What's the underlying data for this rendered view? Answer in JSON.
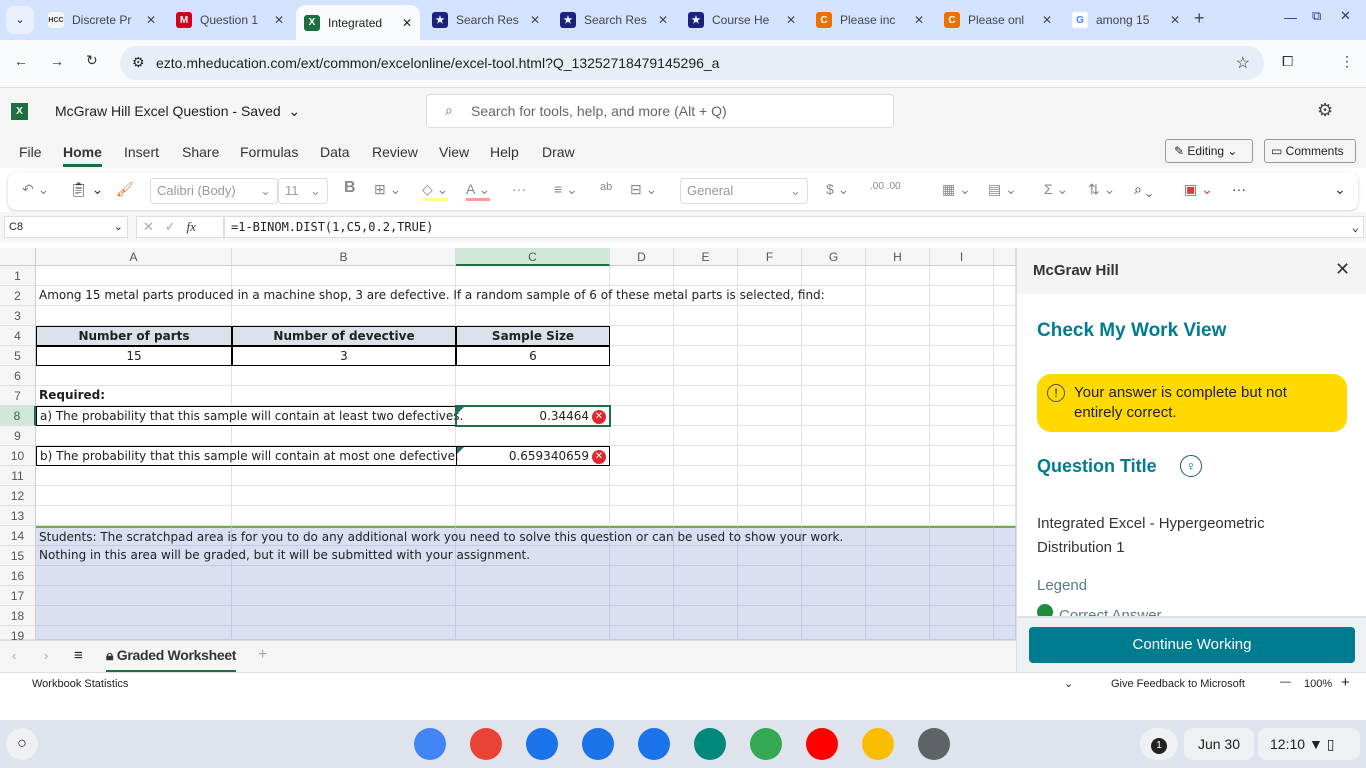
{
  "browser": {
    "tabs": [
      {
        "label": "Discrete Pr",
        "icon": "hcc-icon",
        "color": "#f5f5f5",
        "glyph": "HCC"
      },
      {
        "label": "Question 1",
        "icon": "mcgraw-icon",
        "color": "#d0021b",
        "glyph": "M"
      },
      {
        "label": "Integrated",
        "icon": "excel-icon",
        "color": "#1d6f42",
        "glyph": "X"
      },
      {
        "label": "Search Res",
        "icon": "shield-icon",
        "color": "#1a237e",
        "glyph": "★"
      },
      {
        "label": "Search Res",
        "icon": "shield-icon",
        "color": "#1a237e",
        "glyph": "★"
      },
      {
        "label": "Course He",
        "icon": "shield-icon",
        "color": "#1a237e",
        "glyph": "★"
      },
      {
        "label": "Please inc",
        "icon": "chegg-icon",
        "color": "#eb7100",
        "glyph": "C"
      },
      {
        "label": "Please onl",
        "icon": "chegg-icon",
        "color": "#eb7100",
        "glyph": "C"
      },
      {
        "label": "among 15",
        "icon": "google-icon",
        "color": "#fff",
        "glyph": "G"
      }
    ],
    "url": "ezto.mheducation.com/ext/common/excelonline/excel-tool.html?Q_13252718479145296_a"
  },
  "excel": {
    "title": "McGraw Hill Excel Question",
    "saved": "Saved",
    "search_placeholder": "Search for tools, help, and more (Alt + Q)",
    "menu": [
      "File",
      "Home",
      "Insert",
      "Share",
      "Formulas",
      "Data",
      "Review",
      "View",
      "Help",
      "Draw"
    ],
    "active_menu": "Home",
    "editing": "Editing",
    "comments": "Comments",
    "font": "Calibri (Body)",
    "font_size": "11",
    "number_format": "General",
    "name_box": "C8",
    "formula": "=1-BINOM.DIST(1,C5,0.2,TRUE)",
    "columns": [
      "A",
      "B",
      "C",
      "D",
      "E",
      "F",
      "G",
      "H",
      "I"
    ],
    "selected_column": "C",
    "selected_row": 8,
    "cells": {
      "A2": "Among 15 metal parts produced in a machine shop, 3 are defective. If a random sample of 6 of these metal parts is selected, find:",
      "A4": "Number of parts",
      "B4": "Number of devective",
      "C4": "Sample Size",
      "A5": "15",
      "B5": "3",
      "C5": "6",
      "A7": "Required:",
      "A8": "a) The probability that this sample will contain at least two defectives.",
      "C8": "0.34464",
      "A10": "b) The probability that this sample will contain at most one defective.",
      "C10": "0.659340659",
      "A14": "Students: The scratchpad area is for you to do any additional work you need to solve this question or can be used to show your work.",
      "A15": "Nothing in this area will be graded, but it will be submitted with your assignment."
    },
    "incorrect_cells": [
      "C8",
      "C10"
    ],
    "sheet_tab": "Graded Worksheet",
    "status_left": "Workbook Statistics",
    "feedback": "Give Feedback to Microsoft",
    "zoom": "100%"
  },
  "panel": {
    "brand": "McGraw Hill",
    "heading": "Check My Work View",
    "alert": "Your answer is complete but not entirely correct.",
    "question_title_label": "Question Title",
    "question_title": "Integrated Excel - Hypergeometric Distribution 1",
    "legend": "Legend",
    "legend_correct": "Correct Answer",
    "continue": "Continue Working",
    "accent": "#007c91",
    "alert_color": "#ffd900"
  },
  "shelf": {
    "date": "Jun 30",
    "time": "12:10",
    "notifications": "1",
    "apps": [
      {
        "name": "chrome",
        "color": "#4285f4"
      },
      {
        "name": "gmail",
        "color": "#ea4335"
      },
      {
        "name": "calendar",
        "color": "#1a73e8"
      },
      {
        "name": "files",
        "color": "#1a73e8"
      },
      {
        "name": "messages",
        "color": "#1a73e8"
      },
      {
        "name": "meet",
        "color": "#00897b"
      },
      {
        "name": "play-store",
        "color": "#34a853"
      },
      {
        "name": "youtube",
        "color": "#ff0000"
      },
      {
        "name": "photos",
        "color": "#fbbc04"
      },
      {
        "name": "settings",
        "color": "#5f6368"
      }
    ]
  }
}
